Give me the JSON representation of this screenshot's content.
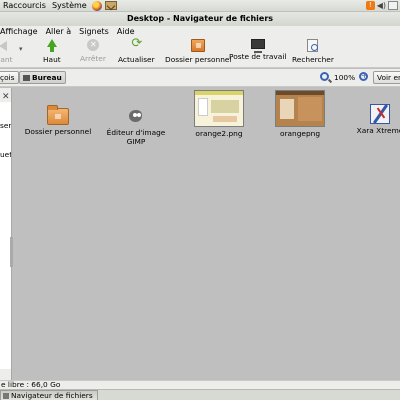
{
  "top_panel": {
    "menus": [
      "Raccourcis",
      "Système"
    ]
  },
  "window": {
    "title": "Desktop - Navigateur de fichiers"
  },
  "menubar": {
    "items": [
      "Affichage",
      "Aller à",
      "Signets",
      "Aide"
    ]
  },
  "toolbar": {
    "back_label": "vant",
    "up_label": "Haut",
    "stop_label": "Arrêter",
    "reload_label": "Actualiser",
    "home_label": "Dossier personnel",
    "computer_label": "Poste de travail",
    "search_label": "Rechercher"
  },
  "location": {
    "crumb_prev": "çois",
    "crumb_current": "Bureau",
    "zoom": "100%",
    "view_as": "Voir en"
  },
  "sidebar": {
    "line1": "sers",
    "line2": "uett"
  },
  "files": [
    {
      "name": "Dossier personnel",
      "kind": "folder-icon"
    },
    {
      "name": "Éditeur d'image GIMP",
      "kind": "gimp-icon"
    },
    {
      "name": "orange2.png",
      "kind": "image-thumbnail"
    },
    {
      "name": "orangepng",
      "kind": "image-thumbnail"
    },
    {
      "name": "Xara Xtreme",
      "kind": "xara-icon"
    }
  ],
  "status": {
    "text": "e libre : 66,0 Go"
  },
  "taskbar": {
    "task_label": "Navigateur de fichiers"
  }
}
